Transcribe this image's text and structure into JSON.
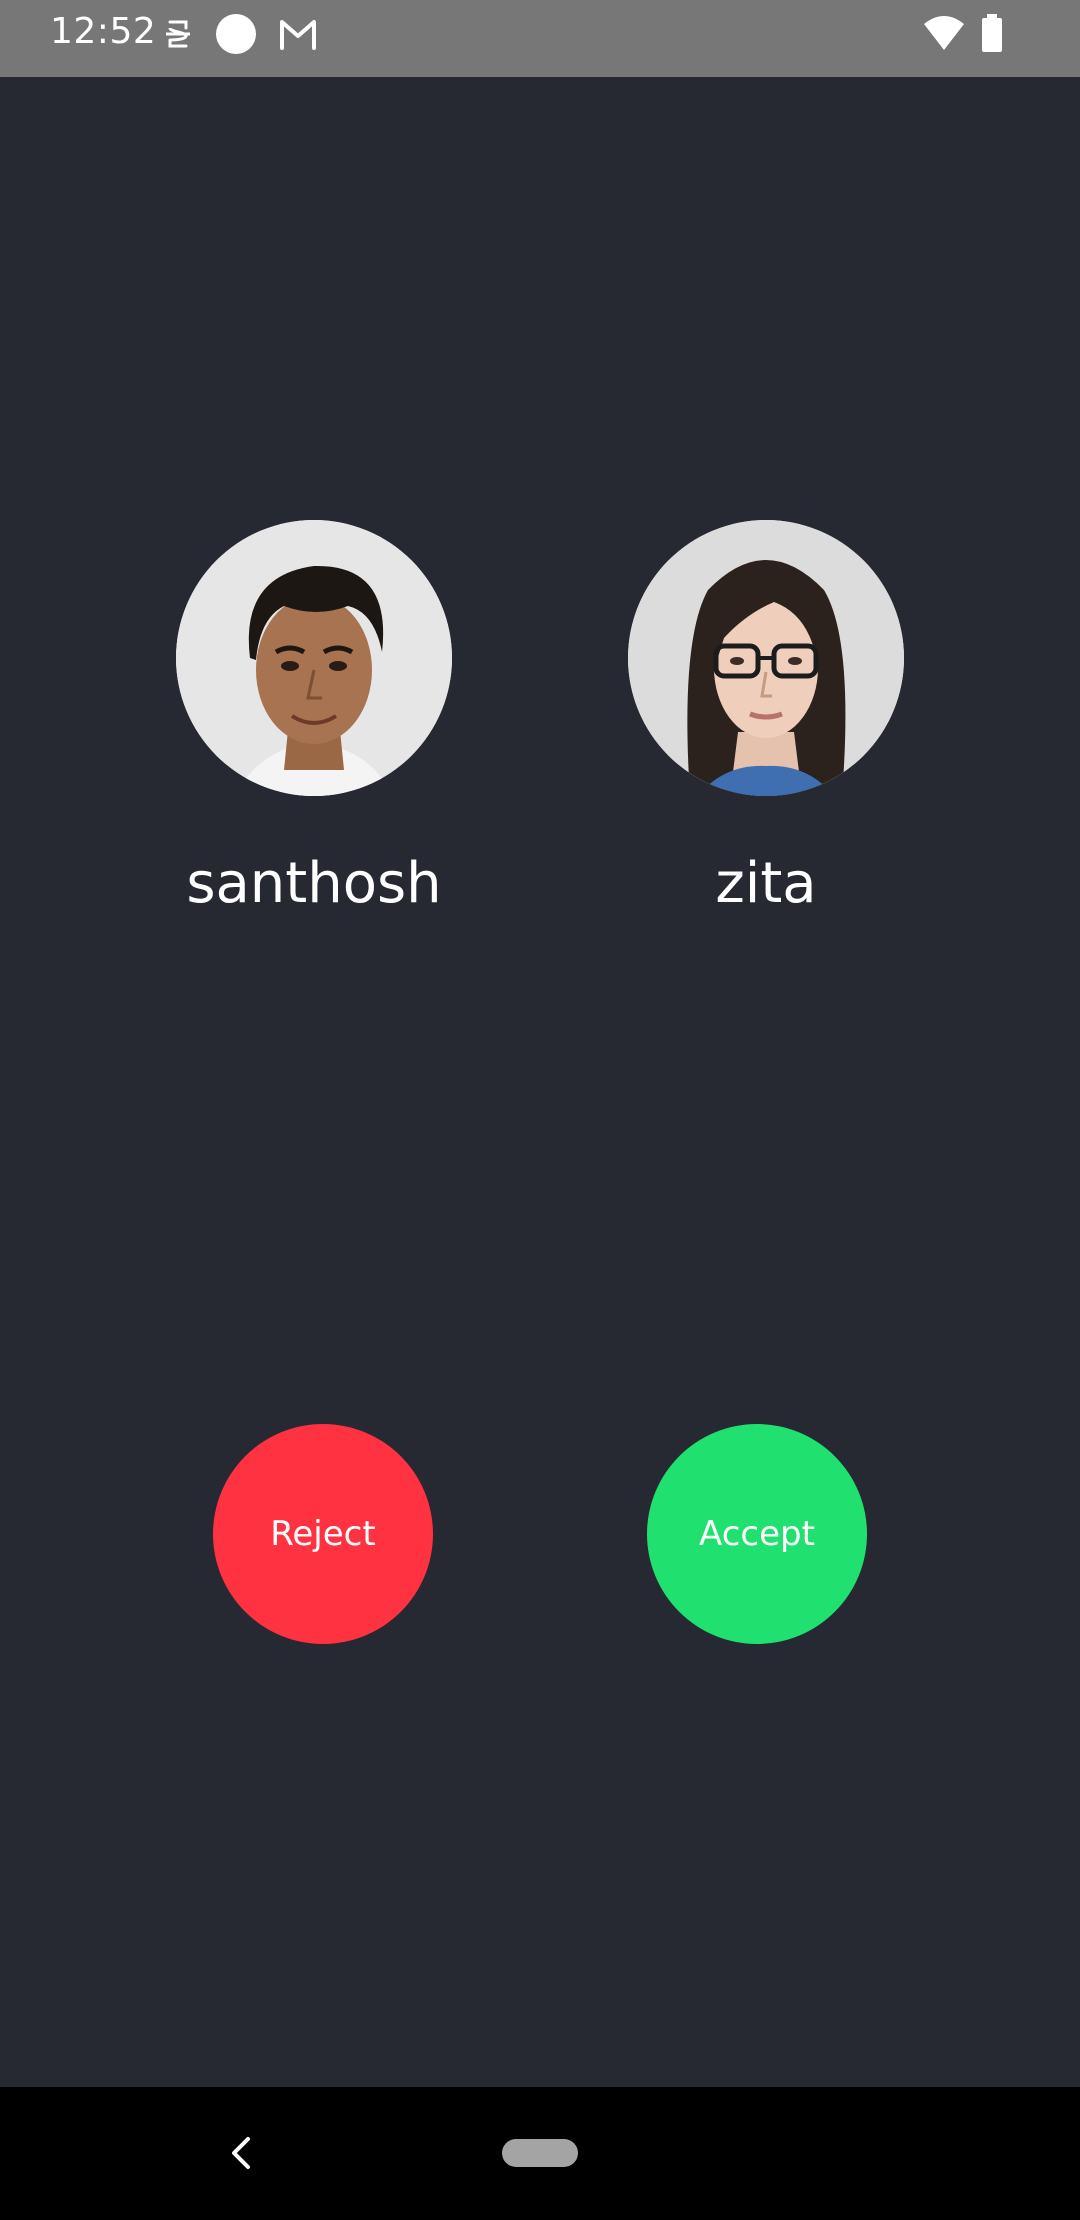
{
  "status_bar": {
    "time": "12:52",
    "icons": [
      "sync-icon",
      "circle-icon",
      "gmail-icon",
      "wifi-icon",
      "battery-icon"
    ]
  },
  "participants": [
    {
      "name": "santhosh",
      "avatar": "santhosh-avatar"
    },
    {
      "name": "zita",
      "avatar": "zita-avatar"
    }
  ],
  "actions": {
    "reject_label": "Reject",
    "accept_label": "Accept"
  },
  "colors": {
    "background": "#272932",
    "reject": "#fe3240",
    "accept": "#20e16f",
    "status_bar": "#777777"
  },
  "navigation": {
    "icons": [
      "back-icon",
      "home-pill"
    ]
  }
}
